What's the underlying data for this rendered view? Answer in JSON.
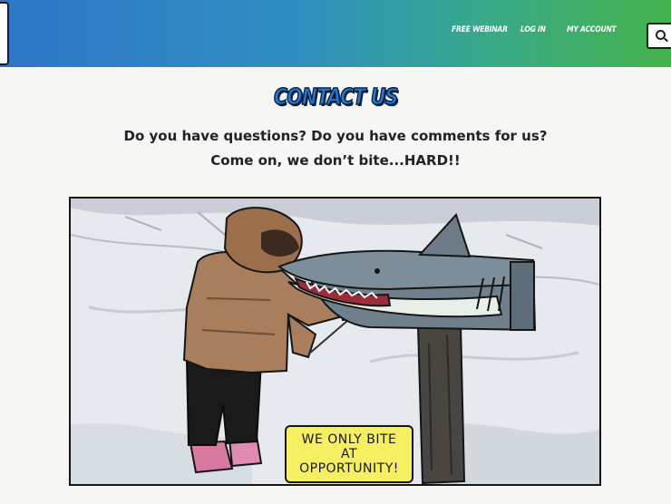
{
  "header": {
    "nav": [
      {
        "label": "FREE WEBINAR"
      },
      {
        "label": "LOG IN"
      },
      {
        "label": "MY ACCOUNT"
      }
    ],
    "search_icon": "search-icon"
  },
  "main": {
    "title": "CONTACT US",
    "subtitle_line1": "Do you have questions? Do you have comments for us?",
    "subtitle_line2": "Come on, we don’t bite...HARD!!",
    "comic_caption": "WE ONLY BITE\nAT\nOPPORTUNITY!"
  },
  "colors": {
    "header_gradient_start": "#2f76c9",
    "header_gradient_end": "#45b34c",
    "title_fill": "#1f7fd6",
    "caption_bg": "#f6ef62"
  }
}
